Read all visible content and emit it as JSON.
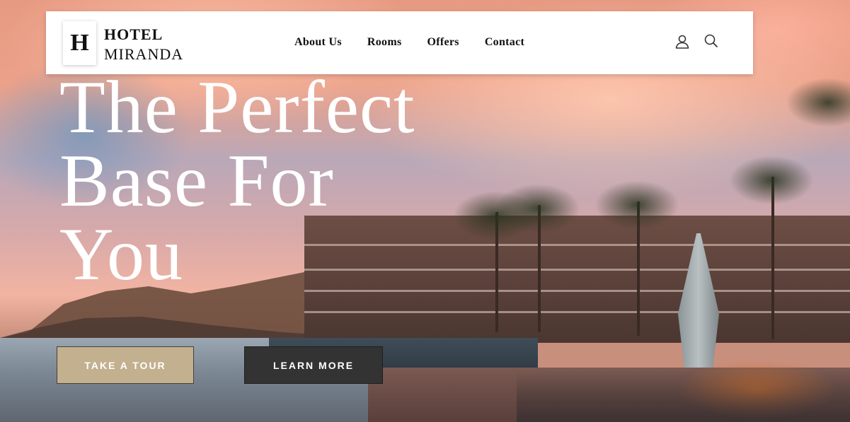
{
  "header": {
    "logo_letter": "H",
    "brand_line1": "HOTEL",
    "brand_line2": "MIRANDA",
    "nav": [
      {
        "label": "About Us"
      },
      {
        "label": "Rooms"
      },
      {
        "label": "Offers"
      },
      {
        "label": "Contact"
      }
    ],
    "icons": [
      "user-icon",
      "search-icon"
    ]
  },
  "hero": {
    "headline_lines": [
      "The Perfect",
      "Base For",
      "You"
    ],
    "buttons": {
      "tour_label": "TAKE A TOUR",
      "learn_label": "LEARN MORE"
    }
  },
  "colors": {
    "tour_button": "#c2b08f",
    "learn_button": "#333333",
    "nav_background": "#ffffff",
    "headline": "#ffffff"
  }
}
